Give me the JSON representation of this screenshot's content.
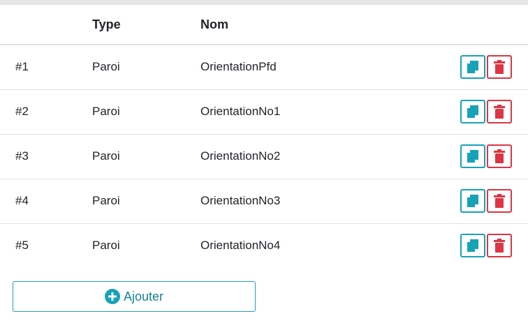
{
  "table": {
    "headers": {
      "num": "",
      "type": "Type",
      "nom": "Nom"
    },
    "rows": [
      {
        "num": "#1",
        "type": "Paroi",
        "nom": "OrientationPfd"
      },
      {
        "num": "#2",
        "type": "Paroi",
        "nom": "OrientationNo1"
      },
      {
        "num": "#3",
        "type": "Paroi",
        "nom": "OrientationNo2"
      },
      {
        "num": "#4",
        "type": "Paroi",
        "nom": "OrientationNo3"
      },
      {
        "num": "#5",
        "type": "Paroi",
        "nom": "OrientationNo4"
      }
    ]
  },
  "icons": {
    "copy": "copy-icon",
    "delete": "trash-icon",
    "add": "plus-circle-icon"
  },
  "colors": {
    "accent": "#17a2b8",
    "danger": "#dc3545"
  },
  "add_button": {
    "label": "Ajouter"
  }
}
